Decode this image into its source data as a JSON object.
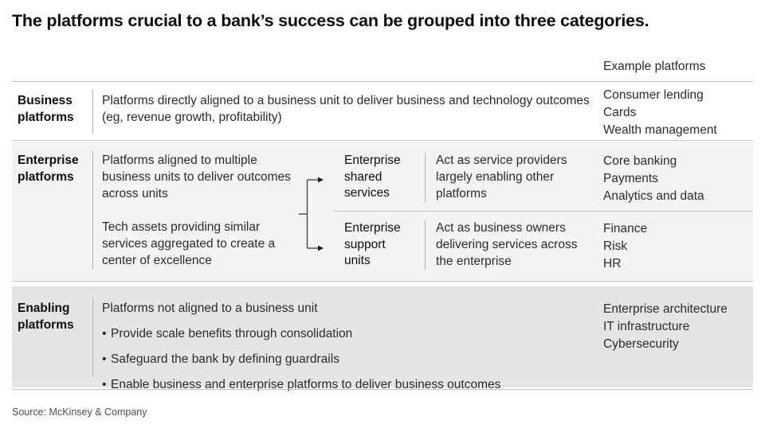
{
  "title": "The platforms crucial to a bank’s success can be grouped into three categories.",
  "column_header": "Example platforms",
  "rows": {
    "business": {
      "label": "Business\nplatforms",
      "description": "Platforms directly aligned to a business unit to deliver business and technology outcomes (eg, revenue growth, profitability)",
      "examples": [
        "Consumer lending",
        "Cards",
        "Wealth management"
      ]
    },
    "enterprise": {
      "label": "Enterprise\nplatforms",
      "description_1": "Platforms aligned to multiple business units to deliver outcomes across units",
      "description_2": "Tech assets providing similar services aggregated to create a center of excellence",
      "sub_rows": [
        {
          "title": "Enterprise\nshared\nservices",
          "description": "Act as service providers largely enabling other platforms",
          "examples": [
            "Core banking",
            "Payments",
            "Analytics and data"
          ]
        },
        {
          "title": "Enterprise\nsupport\nunits",
          "description": "Act as business owners delivering services across the enterprise",
          "examples": [
            "Finance",
            "Risk",
            "HR"
          ]
        }
      ]
    },
    "enabling": {
      "label": "Enabling\nplatforms",
      "description": "Platforms not aligned to a business unit",
      "bullets": [
        "Provide scale benefits through consolidation",
        "Safeguard the bank by defining guardrails",
        "Enable business and enterprise platforms to deliver business outcomes"
      ],
      "examples": [
        "Enterprise architecture",
        "IT infrastructure",
        "Cybersecurity"
      ]
    }
  },
  "source": "Source: McKinsey & Company",
  "colors": {
    "row_business_bg": "#ffffff",
    "row_enterprise_bg": "#f4f4f5",
    "row_enabling_bg": "#e4e5e7",
    "rule": "#c4c4c4",
    "text": "#2b2b2b",
    "heading": "#0d0d0d"
  }
}
